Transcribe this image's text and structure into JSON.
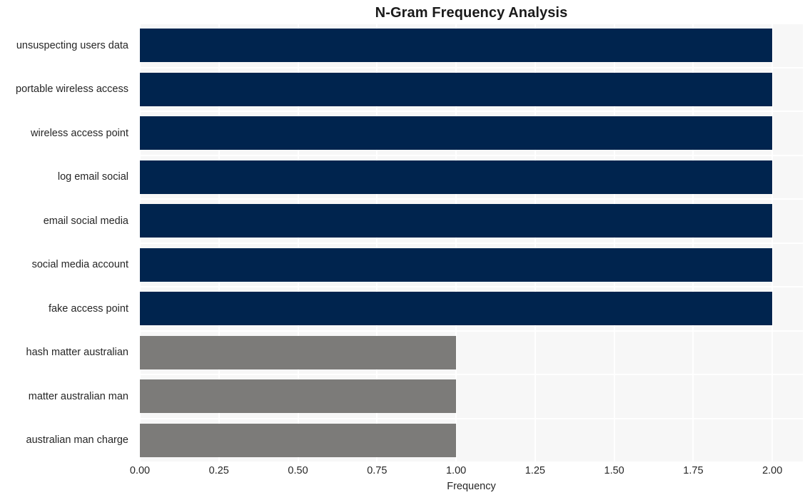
{
  "chart_data": {
    "type": "bar",
    "orientation": "horizontal",
    "title": "N-Gram Frequency Analysis",
    "xlabel": "Frequency",
    "ylabel": "",
    "xlim": [
      0.0,
      2.0966
    ],
    "xticks": [
      "0.00",
      "0.25",
      "0.50",
      "0.75",
      "1.00",
      "1.25",
      "1.50",
      "1.75",
      "2.00"
    ],
    "xtick_values": [
      0.0,
      0.25,
      0.5,
      0.75,
      1.0,
      1.25,
      1.5,
      1.75,
      2.0
    ],
    "grid": true,
    "legend": "none",
    "categories": [
      "unsuspecting users data",
      "portable wireless access",
      "wireless access point",
      "log email social",
      "email social media",
      "social media account",
      "fake access point",
      "hash matter australian",
      "matter australian man",
      "australian man charge"
    ],
    "values": [
      2,
      2,
      2,
      2,
      2,
      2,
      2,
      1,
      1,
      1
    ],
    "bar_colors": [
      "#00244e",
      "#00244e",
      "#00244e",
      "#00244e",
      "#00244e",
      "#00244e",
      "#00244e",
      "#7c7b79",
      "#7c7b79",
      "#7c7b79"
    ],
    "colors": {
      "high_frequency_bar": "#00244e",
      "low_frequency_bar": "#7c7b79",
      "plot_background": "#f7f7f7",
      "gridline": "#ffffff",
      "figure_background": "#ffffff",
      "text": "#262626",
      "title_text": "#1a1a1a"
    }
  }
}
